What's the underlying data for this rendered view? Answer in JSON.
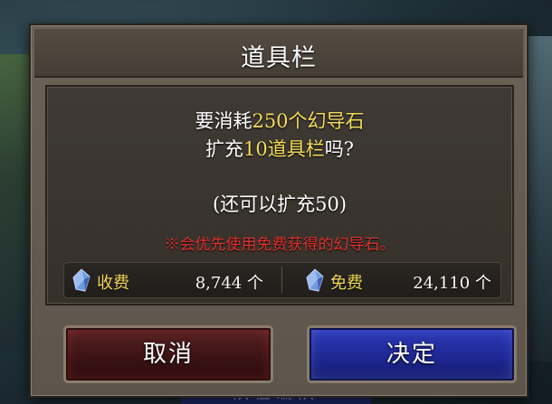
{
  "dialog": {
    "title": "道具栏",
    "message_line1_prefix": "要消耗",
    "message_line1_highlight": "250个幻导石",
    "message_line2_prefix": "扩充",
    "message_line2_highlight": "10道具栏",
    "message_line2_suffix": "吗?",
    "remaining": "(还可以扩充50)",
    "notice": "※会优先使用免费获得的幻导石。"
  },
  "costs": {
    "paid_label": "收费",
    "paid_value": "8,744 个",
    "free_label": "免费",
    "free_value": "24,110 个"
  },
  "buttons": {
    "cancel": "取消",
    "confirm": "决定"
  },
  "background": {
    "bottom_tab": "队伍编队"
  },
  "icons": {
    "paid": "crystal-icon",
    "free": "crystal-icon"
  },
  "colors": {
    "highlight": "#f3dc5a",
    "notice": "#e0312f",
    "cancel_button": "#3a1214",
    "confirm_button": "#1d2690"
  }
}
